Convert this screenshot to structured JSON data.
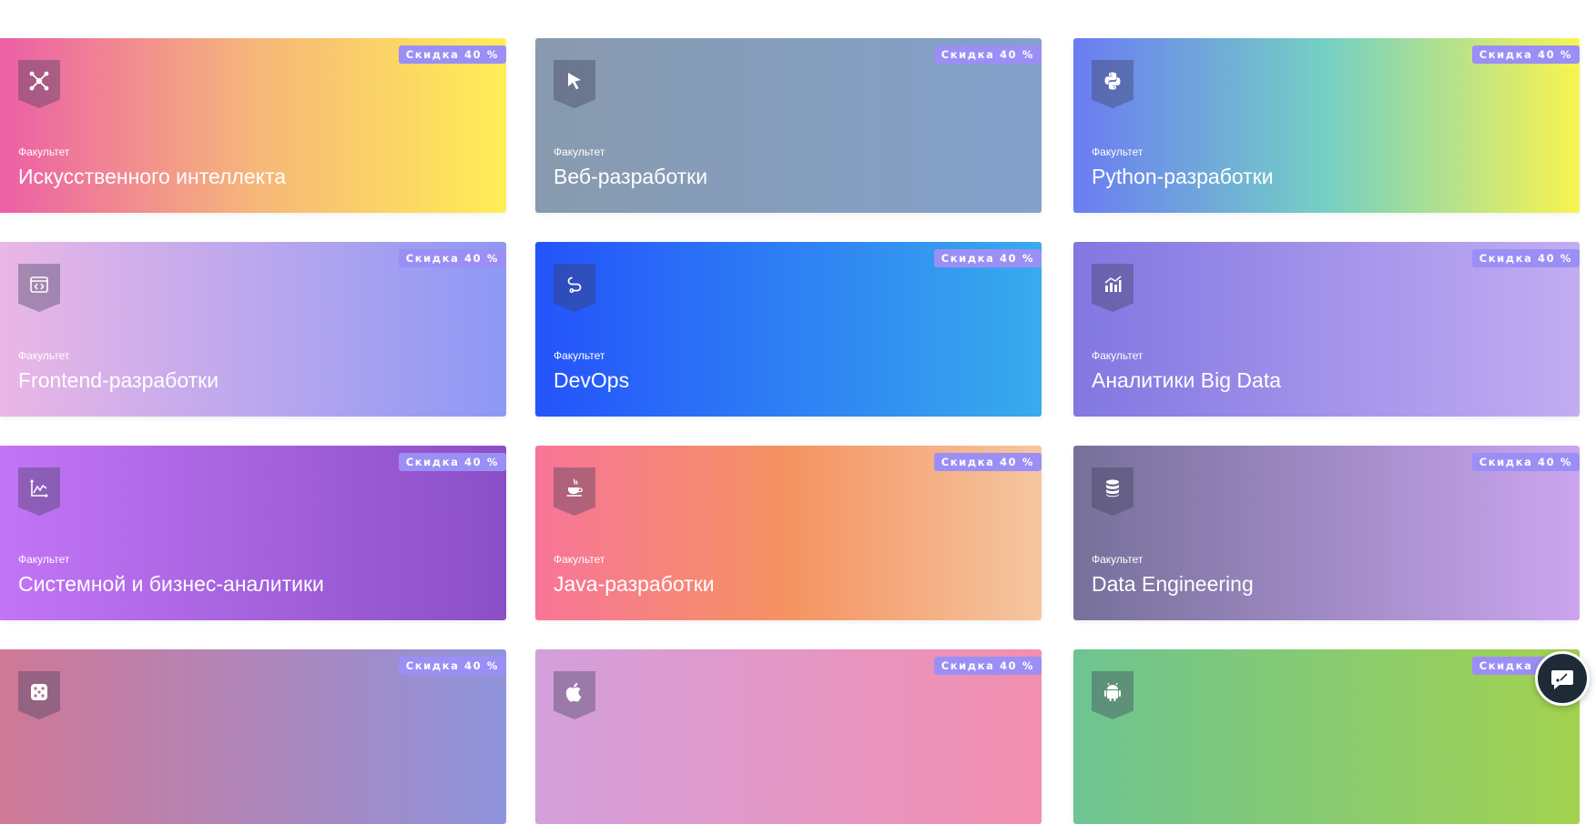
{
  "cards": [
    {
      "caption": "Факультет",
      "title": "Искусственного интеллекта",
      "badge": "Скидка 40 %",
      "icon": "neural-network-icon",
      "gradient": [
        "#ec5fa6",
        "#f6b67a",
        "#ffee55"
      ]
    },
    {
      "caption": "Факультет",
      "title": "Веб-разработки",
      "badge": "Скидка 40 %",
      "icon": "cursor-icon",
      "gradient": [
        "#889aae",
        "#84a1cc"
      ]
    },
    {
      "caption": "Факультет",
      "title": "Python-разработки",
      "badge": "Скидка 40 %",
      "icon": "python-icon",
      "gradient": [
        "#6a7cf2",
        "#75d0c4",
        "#f8f450"
      ]
    },
    {
      "caption": "Факультет",
      "title": "Frontend-разработки",
      "badge": "Скидка 40 %",
      "icon": "code-window-icon",
      "gradient": [
        "#eab7e6",
        "#8d98f5"
      ]
    },
    {
      "caption": "Факультет",
      "title": "DevOps",
      "badge": "Скидка 40 %",
      "icon": "devops-loop-icon",
      "gradient": [
        "#2453fb",
        "#38abed"
      ]
    },
    {
      "caption": "Факультет",
      "title": "Аналитики Big Data",
      "badge": "Скидка 40 %",
      "icon": "bar-chart-icon",
      "gradient": [
        "#8277e2",
        "#c2adf2"
      ]
    },
    {
      "caption": "Факультет",
      "title": "Системной и бизнес-аналитики",
      "badge": "Скидка 40 %",
      "icon": "line-chart-icon",
      "gradient": [
        "#c275f6",
        "#8a4fc6"
      ]
    },
    {
      "caption": "Факультет",
      "title": "Java-разработки",
      "badge": "Скидка 40 %",
      "icon": "java-cup-icon",
      "gradient": [
        "#f77598",
        "#f59361",
        "#f5c6a0"
      ]
    },
    {
      "caption": "Факультет",
      "title": "Data Engineering",
      "badge": "Скидка 40 %",
      "icon": "database-icon",
      "gradient": [
        "#76709a",
        "#cba5ef"
      ]
    },
    {
      "caption": "",
      "title": "",
      "badge": "Скидка 40 %",
      "icon": "dice-icon",
      "gradient": [
        "#d07896",
        "#8f94dc"
      ]
    },
    {
      "caption": "",
      "title": "",
      "badge": "Скидка 40 %",
      "icon": "apple-icon",
      "gradient": [
        "#d3a0dc",
        "#f38eae"
      ]
    },
    {
      "caption": "",
      "title": "",
      "badge": "Скидка 40 %",
      "icon": "android-icon",
      "gradient": [
        "#6ec492",
        "#a2d24f"
      ]
    }
  ],
  "chat": {
    "icon": "chat-bubble-icon"
  }
}
